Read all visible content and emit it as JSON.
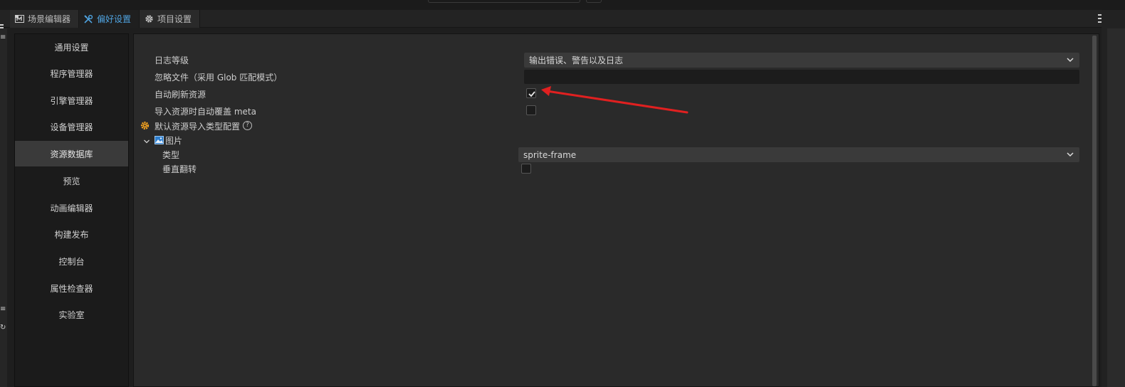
{
  "tabs": [
    {
      "label": "场景编辑器",
      "icon": "scene-editor-icon",
      "active": false
    },
    {
      "label": "偏好设置",
      "icon": "tools-icon",
      "active": true
    },
    {
      "label": "项目设置",
      "icon": "gear-icon",
      "active": false
    }
  ],
  "sidebar": {
    "items": [
      {
        "label": "通用设置"
      },
      {
        "label": "程序管理器"
      },
      {
        "label": "引擎管理器"
      },
      {
        "label": "设备管理器"
      },
      {
        "label": "资源数据库",
        "active": true
      },
      {
        "label": "预览"
      },
      {
        "label": "动画编辑器"
      },
      {
        "label": "构建发布"
      },
      {
        "label": "控制台"
      },
      {
        "label": "属性检查器"
      },
      {
        "label": "实验室"
      }
    ]
  },
  "settings": {
    "log_level": {
      "label": "日志等级",
      "value": "输出错误、警告以及日志"
    },
    "ignore_files": {
      "label": "忽略文件（采用 Glob 匹配模式）",
      "value": ""
    },
    "auto_refresh": {
      "label": "自动刷新资源",
      "checked": true
    },
    "auto_overwrite_meta": {
      "label": "导入资源时自动覆盖 meta",
      "checked": false
    },
    "default_import_config": {
      "label": "默认资源导入类型配置"
    },
    "image_group": {
      "label": "图片",
      "type": {
        "label": "类型",
        "value": "sprite-frame"
      },
      "flip_vertical": {
        "label": "垂直翻转",
        "checked": false
      }
    }
  },
  "colors": {
    "accent": "#4fa3e0",
    "annotation_arrow": "#e02020",
    "config_icon": "#f0a020"
  }
}
